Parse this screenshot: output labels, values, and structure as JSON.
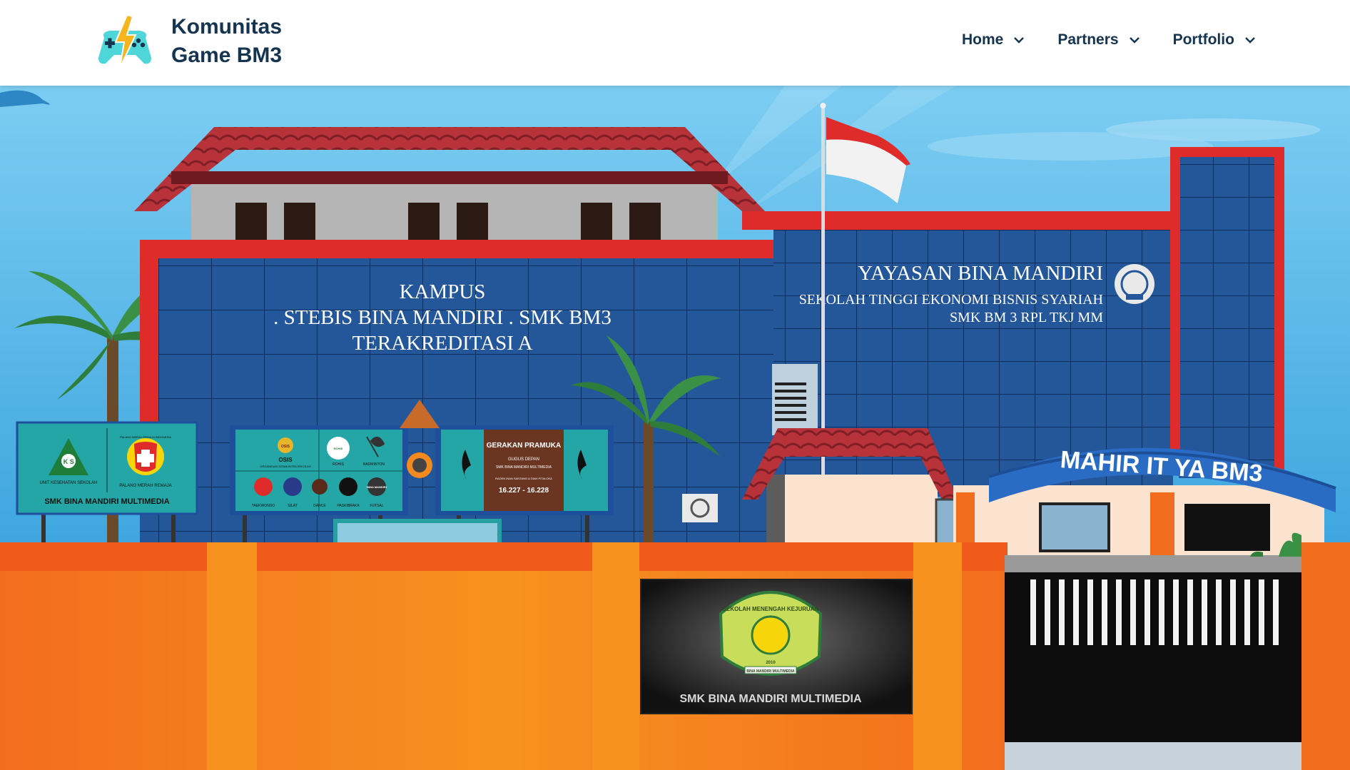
{
  "header": {
    "brand_line1": "Komunitas",
    "brand_line2": "Game BM3",
    "logo_icon": "gamepad-lightning-icon"
  },
  "nav": [
    {
      "label": "Home",
      "icon": "chevron-down-icon"
    },
    {
      "label": "Partners",
      "icon": "chevron-down-icon"
    },
    {
      "label": "Portfolio",
      "icon": "chevron-down-icon"
    }
  ],
  "hero": {
    "campus_line1": "KAMPUS",
    "campus_line2": ". STEBIS BINA MANDIRI . SMK BM3",
    "campus_line3": "TERAKREDITASI A",
    "foundation_title": "YAYASAN BINA MANDIRI",
    "foundation_line1": "SEKOLAH TINGGI EKONOMI BISNIS SYARIAH",
    "foundation_line2": "SMK BM 3 RPL TKJ MM",
    "arch_text": "MAHIR IT YA BM3",
    "school_plaque": "SMK BINA MANDIRI MULTIMEDIA",
    "plaque_arc": "SEKOLAH MENENGAH KEJURUAN",
    "plaque_year": "2010",
    "plaque_ribbon": "BINA MANDIRI MULTIMEDIA",
    "sign1": {
      "uks_letters": "U K S S",
      "left_caption": "UNIT KESEHATAN SEKOLAH",
      "right_caption": "PALANG MERAH REMAJA",
      "badge_text": "PALANG MERAH REMAJA INDONESIA",
      "footer": "SMK BINA MANDIRI MULTIMEDIA"
    },
    "sign2": {
      "osis": "OSIS",
      "osis_sub": "ORGANISASI SISWA INTRA SEKOLAH",
      "labels": [
        "ROHIS",
        "BADMINTON",
        "TAEKWONDO",
        "SILAT",
        "DANCE",
        "PASKIBRAKA",
        "FUTSAL"
      ],
      "top_badges": [
        "OSIS",
        "ROHIS"
      ],
      "badge_marks": [
        "BINA MANDIRI"
      ]
    },
    "sign3": {
      "title": "GERAKAN PRAMUKA",
      "line1": "GUGUS DEPAN",
      "line2": "SMK BINA MANDIRI MULTIMEDIA",
      "line3": "RADEN INAN SANTANG & DIAH PITALOKA",
      "numbers": "16.227 - 16.228"
    },
    "colors": {
      "sky": "#5fb8e8",
      "glass": "#24579a",
      "roof": "#b8323a",
      "wall": "#f7841f",
      "red_trim": "#e02b2b",
      "brand": "#15344f"
    }
  }
}
